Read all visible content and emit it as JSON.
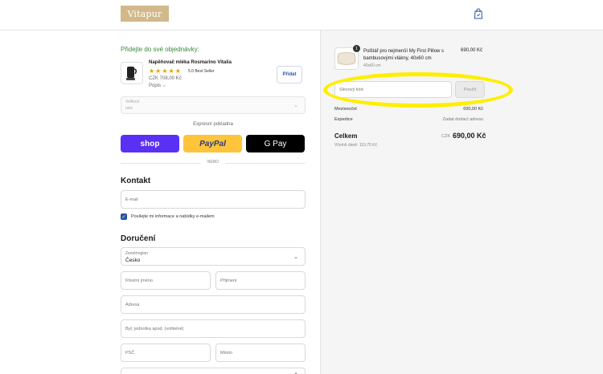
{
  "header": {
    "logo_text": "Vitapur",
    "cart_icon": "shopping-bag-icon"
  },
  "upsell": {
    "title": "Přidejte do své objednávky:",
    "product_name": "Napěňovač mléka Rosmarino Vitalia",
    "stars": "★★★★★",
    "rating_text": "5.0 Best Seller",
    "price": "CZK 708,00 Kč",
    "popis": "Popis ⌵",
    "add_label": "Přidat",
    "variant_label": "Velikost",
    "variant_value": "univ"
  },
  "express": {
    "label": "Expresní pokladna",
    "shop_label": "shop",
    "paypal_label": "PayPal",
    "gpay_label": "G Pay",
    "or_label": "NEBO"
  },
  "contact": {
    "heading": "Kontakt",
    "email_placeholder": "E-mail",
    "newsletter_label": "Posílejte mi informace a nabídky e-mailem",
    "newsletter_checked": true
  },
  "delivery": {
    "heading": "Doručení",
    "country_label": "Země/region",
    "country_value": "Česko",
    "first_name_placeholder": "Křestní jméno",
    "last_name_placeholder": "Příjmení",
    "address_placeholder": "Adresa",
    "apt_placeholder": "Byt, jednotka apod. (volitelné)",
    "zip_placeholder": "PSČ",
    "city_placeholder": "Město"
  },
  "summary": {
    "product_name": "Polštář pro nejmenší My First Pillow s bambusovými vlákny, 40x60 cm",
    "product_variant": "40x60 cm",
    "product_qty": "1",
    "product_price": "690,00 Kč",
    "discount_placeholder": "Slevový kód",
    "apply_label": "Použít",
    "subtotal_label": "Mezisoučet",
    "subtotal_value": "690,00 Kč",
    "shipping_label": "Expedice",
    "shipping_value": "Zadat dodací adresu",
    "total_label": "Celkem",
    "total_currency": "CZK",
    "total_value": "690,00 Kč",
    "tax_note": "Včetně daně: 119,75 Kč"
  },
  "highlight_color": "#ffee00",
  "accent_color": "#2856a3"
}
